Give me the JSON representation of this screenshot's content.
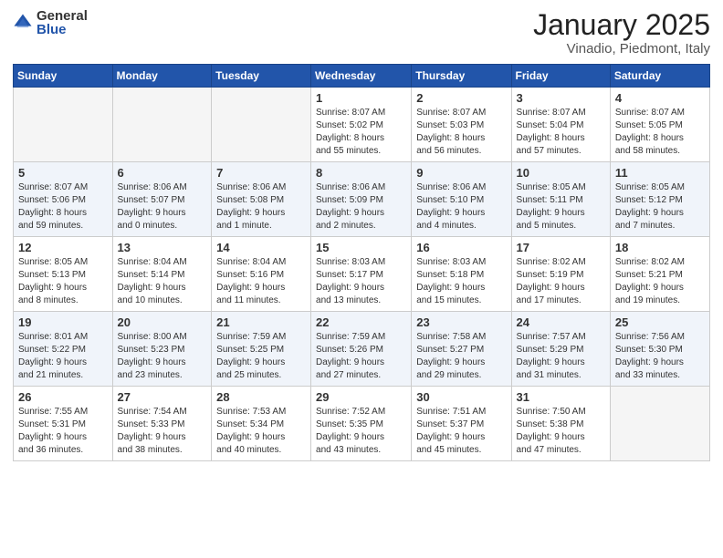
{
  "header": {
    "logo_general": "General",
    "logo_blue": "Blue",
    "month": "January 2025",
    "location": "Vinadio, Piedmont, Italy"
  },
  "days_of_week": [
    "Sunday",
    "Monday",
    "Tuesday",
    "Wednesday",
    "Thursday",
    "Friday",
    "Saturday"
  ],
  "weeks": [
    [
      {
        "day": "",
        "info": ""
      },
      {
        "day": "",
        "info": ""
      },
      {
        "day": "",
        "info": ""
      },
      {
        "day": "1",
        "info": "Sunrise: 8:07 AM\nSunset: 5:02 PM\nDaylight: 8 hours\nand 55 minutes."
      },
      {
        "day": "2",
        "info": "Sunrise: 8:07 AM\nSunset: 5:03 PM\nDaylight: 8 hours\nand 56 minutes."
      },
      {
        "day": "3",
        "info": "Sunrise: 8:07 AM\nSunset: 5:04 PM\nDaylight: 8 hours\nand 57 minutes."
      },
      {
        "day": "4",
        "info": "Sunrise: 8:07 AM\nSunset: 5:05 PM\nDaylight: 8 hours\nand 58 minutes."
      }
    ],
    [
      {
        "day": "5",
        "info": "Sunrise: 8:07 AM\nSunset: 5:06 PM\nDaylight: 8 hours\nand 59 minutes."
      },
      {
        "day": "6",
        "info": "Sunrise: 8:06 AM\nSunset: 5:07 PM\nDaylight: 9 hours\nand 0 minutes."
      },
      {
        "day": "7",
        "info": "Sunrise: 8:06 AM\nSunset: 5:08 PM\nDaylight: 9 hours\nand 1 minute."
      },
      {
        "day": "8",
        "info": "Sunrise: 8:06 AM\nSunset: 5:09 PM\nDaylight: 9 hours\nand 2 minutes."
      },
      {
        "day": "9",
        "info": "Sunrise: 8:06 AM\nSunset: 5:10 PM\nDaylight: 9 hours\nand 4 minutes."
      },
      {
        "day": "10",
        "info": "Sunrise: 8:05 AM\nSunset: 5:11 PM\nDaylight: 9 hours\nand 5 minutes."
      },
      {
        "day": "11",
        "info": "Sunrise: 8:05 AM\nSunset: 5:12 PM\nDaylight: 9 hours\nand 7 minutes."
      }
    ],
    [
      {
        "day": "12",
        "info": "Sunrise: 8:05 AM\nSunset: 5:13 PM\nDaylight: 9 hours\nand 8 minutes."
      },
      {
        "day": "13",
        "info": "Sunrise: 8:04 AM\nSunset: 5:14 PM\nDaylight: 9 hours\nand 10 minutes."
      },
      {
        "day": "14",
        "info": "Sunrise: 8:04 AM\nSunset: 5:16 PM\nDaylight: 9 hours\nand 11 minutes."
      },
      {
        "day": "15",
        "info": "Sunrise: 8:03 AM\nSunset: 5:17 PM\nDaylight: 9 hours\nand 13 minutes."
      },
      {
        "day": "16",
        "info": "Sunrise: 8:03 AM\nSunset: 5:18 PM\nDaylight: 9 hours\nand 15 minutes."
      },
      {
        "day": "17",
        "info": "Sunrise: 8:02 AM\nSunset: 5:19 PM\nDaylight: 9 hours\nand 17 minutes."
      },
      {
        "day": "18",
        "info": "Sunrise: 8:02 AM\nSunset: 5:21 PM\nDaylight: 9 hours\nand 19 minutes."
      }
    ],
    [
      {
        "day": "19",
        "info": "Sunrise: 8:01 AM\nSunset: 5:22 PM\nDaylight: 9 hours\nand 21 minutes."
      },
      {
        "day": "20",
        "info": "Sunrise: 8:00 AM\nSunset: 5:23 PM\nDaylight: 9 hours\nand 23 minutes."
      },
      {
        "day": "21",
        "info": "Sunrise: 7:59 AM\nSunset: 5:25 PM\nDaylight: 9 hours\nand 25 minutes."
      },
      {
        "day": "22",
        "info": "Sunrise: 7:59 AM\nSunset: 5:26 PM\nDaylight: 9 hours\nand 27 minutes."
      },
      {
        "day": "23",
        "info": "Sunrise: 7:58 AM\nSunset: 5:27 PM\nDaylight: 9 hours\nand 29 minutes."
      },
      {
        "day": "24",
        "info": "Sunrise: 7:57 AM\nSunset: 5:29 PM\nDaylight: 9 hours\nand 31 minutes."
      },
      {
        "day": "25",
        "info": "Sunrise: 7:56 AM\nSunset: 5:30 PM\nDaylight: 9 hours\nand 33 minutes."
      }
    ],
    [
      {
        "day": "26",
        "info": "Sunrise: 7:55 AM\nSunset: 5:31 PM\nDaylight: 9 hours\nand 36 minutes."
      },
      {
        "day": "27",
        "info": "Sunrise: 7:54 AM\nSunset: 5:33 PM\nDaylight: 9 hours\nand 38 minutes."
      },
      {
        "day": "28",
        "info": "Sunrise: 7:53 AM\nSunset: 5:34 PM\nDaylight: 9 hours\nand 40 minutes."
      },
      {
        "day": "29",
        "info": "Sunrise: 7:52 AM\nSunset: 5:35 PM\nDaylight: 9 hours\nand 43 minutes."
      },
      {
        "day": "30",
        "info": "Sunrise: 7:51 AM\nSunset: 5:37 PM\nDaylight: 9 hours\nand 45 minutes."
      },
      {
        "day": "31",
        "info": "Sunrise: 7:50 AM\nSunset: 5:38 PM\nDaylight: 9 hours\nand 47 minutes."
      },
      {
        "day": "",
        "info": ""
      }
    ]
  ]
}
